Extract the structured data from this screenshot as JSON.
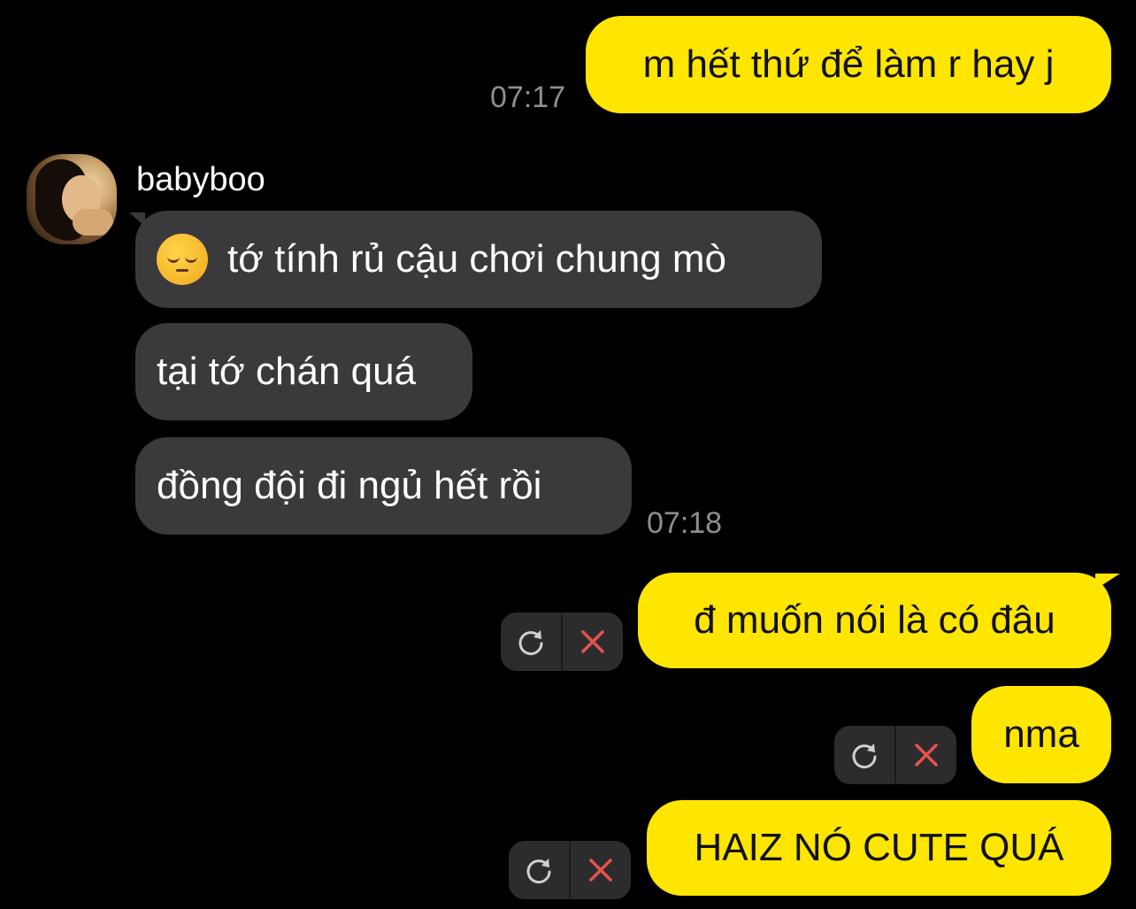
{
  "conversation": {
    "messages": [
      {
        "direction": "outgoing",
        "text": "m hết thứ để làm r hay j",
        "time": "07:17"
      },
      {
        "direction": "incoming",
        "sender": "babyboo",
        "text": "tớ tính rủ cậu chơi chung mò",
        "emoji": "pensive-face-icon"
      },
      {
        "direction": "incoming",
        "text": "tại tớ chán quá"
      },
      {
        "direction": "incoming",
        "text": "đồng đội đi ngủ hết rồi",
        "time": "07:18"
      },
      {
        "direction": "outgoing",
        "text": "đ muốn nói là có đâu",
        "status": "failed"
      },
      {
        "direction": "outgoing",
        "text": "nma",
        "status": "failed"
      },
      {
        "direction": "outgoing",
        "text": "HAIZ NÓ CUTE QUÁ",
        "status": "failed"
      }
    ]
  },
  "colors": {
    "background": "#000000",
    "outgoing_bubble": "#FFE600",
    "incoming_bubble": "#3A3A3C",
    "timestamp": "#8E8E93",
    "action_box": "#2C2C2E",
    "retry_icon": "#D0D0D0",
    "delete_icon": "#E5534B"
  },
  "icons": {
    "retry": "retry-icon",
    "delete": "close-icon",
    "avatar": "avatar"
  }
}
